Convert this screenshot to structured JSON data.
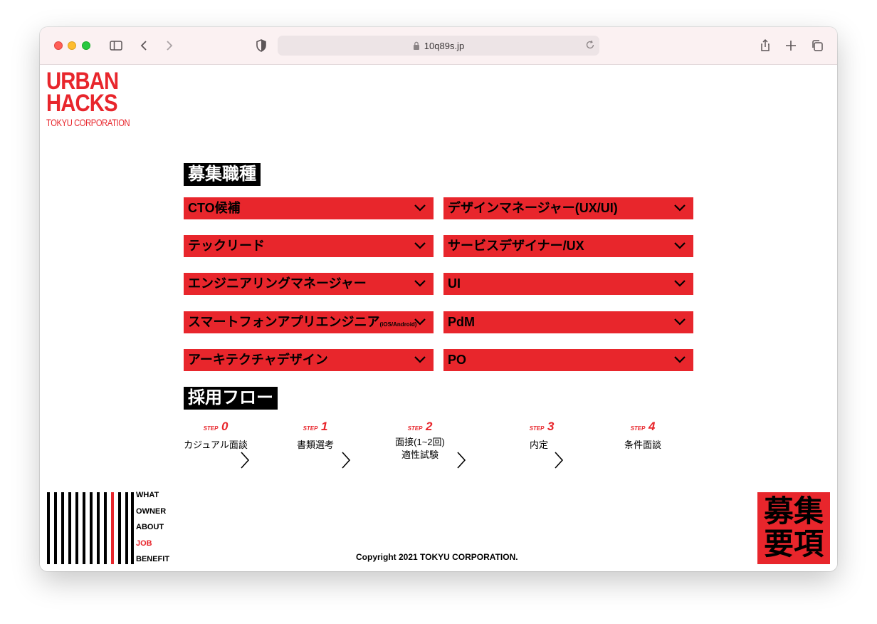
{
  "browser": {
    "url": "10q89s.jp"
  },
  "logo": {
    "line1": "URBAN",
    "line2": "HACKS",
    "line3": "TOKYU CORPORATION"
  },
  "jobs_section": {
    "title": "募集職種",
    "left": [
      {
        "label": "CTO候補",
        "sub": ""
      },
      {
        "label": "テックリード",
        "sub": ""
      },
      {
        "label": "エンジニアリングマネージャー",
        "sub": ""
      },
      {
        "label": "スマートフォンアプリエンジニア",
        "sub": "(iOS/Android)"
      },
      {
        "label": "アーキテクチャデザイン",
        "sub": ""
      }
    ],
    "right": [
      {
        "label": "デザインマネージャー(UX/UI)"
      },
      {
        "label": "サービスデザイナー/UX"
      },
      {
        "label": "UI"
      },
      {
        "label": "PdM"
      },
      {
        "label": "PO"
      }
    ]
  },
  "flow_section": {
    "title": "採用フロー",
    "steps": [
      {
        "step": "STEP",
        "num": "0",
        "line1": "カジュアル面談",
        "line2": ""
      },
      {
        "step": "STEP",
        "num": "1",
        "line1": "書類選考",
        "line2": ""
      },
      {
        "step": "STEP",
        "num": "2",
        "line1": "面接(1~2回)",
        "line2": "適性試験"
      },
      {
        "step": "STEP",
        "num": "3",
        "line1": "内定",
        "line2": ""
      },
      {
        "step": "STEP",
        "num": "4",
        "line1": "条件面談",
        "line2": ""
      }
    ]
  },
  "footer": {
    "nav": [
      "WHAT",
      "OWNER",
      "ABOUT",
      "JOB",
      "BENEFIT"
    ],
    "active": "JOB",
    "copyright": "Copyright 2021 TOKYU CORPORATION.",
    "badge_line1": "募集",
    "badge_line2": "要項"
  },
  "colors": {
    "accent": "#e8262c",
    "title_bg": "#000000"
  }
}
